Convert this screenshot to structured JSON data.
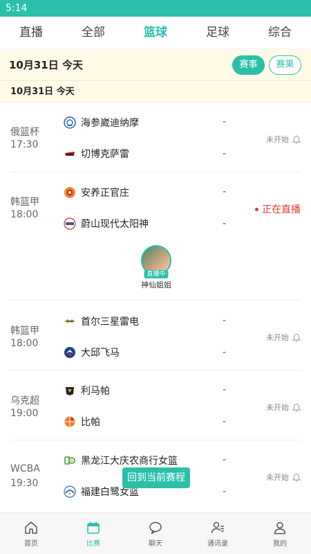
{
  "status_bar": {
    "time": "5:14"
  },
  "tabs": [
    {
      "label": "直播",
      "active": false
    },
    {
      "label": "全部",
      "active": false
    },
    {
      "label": "篮球",
      "active": true
    },
    {
      "label": "足球",
      "active": false
    },
    {
      "label": "综合",
      "active": false
    }
  ],
  "date_header": {
    "date": "10月31日 今天",
    "events_label": "赛事",
    "results_label": "赛果"
  },
  "section_date": "10月31日  今天",
  "matches": [
    {
      "league": "俄篮杯",
      "time": "17:30",
      "home": {
        "name": "海参崴迪纳摩",
        "score": "-"
      },
      "away": {
        "name": "切博克萨雷",
        "score": "-"
      },
      "status": "未开始"
    },
    {
      "league": "韩篮甲",
      "time": "18:00",
      "home": {
        "name": "安养正官庄",
        "score": "-"
      },
      "away": {
        "name": "蔚山现代太阳神",
        "score": "-"
      },
      "status": "正在直播",
      "streamer": {
        "tag": "直播中",
        "name": "神仙姐姐"
      }
    },
    {
      "league": "韩篮甲",
      "time": "18:00",
      "home": {
        "name": "首尔三星雷电",
        "score": "-"
      },
      "away": {
        "name": "大邱飞马",
        "score": "-"
      },
      "status": "未开始"
    },
    {
      "league": "乌克超",
      "time": "19:00",
      "home": {
        "name": "利马帕",
        "score": "-"
      },
      "away": {
        "name": "比帕",
        "score": "-"
      },
      "status": "未开始"
    },
    {
      "league": "WCBA",
      "time": "19:30",
      "home": {
        "name": "黑龙江大庆农商行女篮",
        "score": "-"
      },
      "away": {
        "name": "福建白鹭女篮",
        "score": "-"
      },
      "status": "未开始"
    }
  ],
  "return_button": "回到当前赛程",
  "bottom_nav": [
    {
      "label": "首页",
      "icon": "home-icon",
      "active": false
    },
    {
      "label": "比赛",
      "icon": "calendar-icon",
      "active": true
    },
    {
      "label": "聊天",
      "icon": "chat-icon",
      "active": false
    },
    {
      "label": "通讯录",
      "icon": "contacts-icon",
      "active": false
    },
    {
      "label": "我的",
      "icon": "profile-icon",
      "active": false
    }
  ],
  "colors": {
    "accent": "#2bbfa9",
    "live": "#e53935",
    "date_bg": "#fffbe6"
  }
}
